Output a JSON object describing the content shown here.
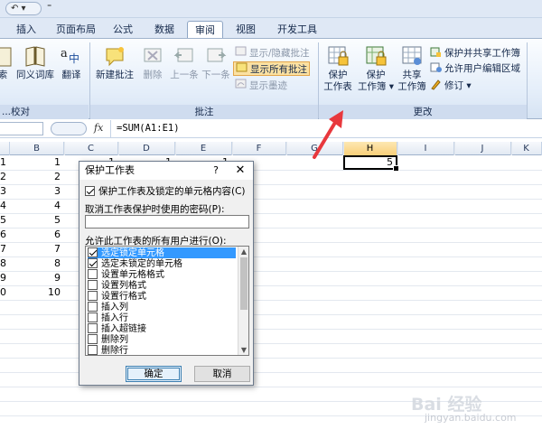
{
  "qat": {
    "undo_label": "↶ ▾",
    "caret": "⁼"
  },
  "tabs": [
    "插入",
    "页面布局",
    "公式",
    "数据",
    "审阅",
    "视图",
    "开发工具"
  ],
  "active_tab_index": 4,
  "ribbon": {
    "proofing": {
      "research_label": "...索",
      "thesaurus_label": "同义词库",
      "translate_label": "翻译",
      "group_label": "...校对"
    },
    "comments": {
      "new_comment_label": "新建批注",
      "delete_label": "删除",
      "previous_label": "上一条",
      "next_label": "下一条",
      "show_hide_label": "显示/隐藏批注",
      "show_all_label": "显示所有批注",
      "show_ink_label": "显示墨迹",
      "group_label": "批注"
    },
    "changes": {
      "protect_sheet_label_1": "保护",
      "protect_sheet_label_2": "工作表",
      "protect_workbook_label_1": "保护",
      "protect_workbook_label_2": "工作簿 ▾",
      "share_workbook_label_1": "共享",
      "share_workbook_label_2": "工作簿",
      "protect_share_label": "保护并共享工作簿",
      "allow_edit_label": "允许用户编辑区域",
      "track_changes_label": "修订 ▾",
      "group_label": "更改"
    }
  },
  "formula_bar": {
    "fx_label": "fx",
    "formula": "=SUM(A1:E1)"
  },
  "columns": [
    "B",
    "C",
    "D",
    "E",
    "F",
    "G",
    "H",
    "I",
    "J",
    "K"
  ],
  "selected_column": "H",
  "rows": [
    {
      "a": "1",
      "b": "1",
      "c": "1",
      "d": "1",
      "e": "1"
    },
    {
      "a": "2",
      "b": "2"
    },
    {
      "a": "3",
      "b": "3"
    },
    {
      "a": "4",
      "b": "4"
    },
    {
      "a": "5",
      "b": "5"
    },
    {
      "a": "6",
      "b": "6"
    },
    {
      "a": "7",
      "b": "7"
    },
    {
      "a": "8",
      "b": "8"
    },
    {
      "a": "9",
      "b": "9"
    },
    {
      "a": "0",
      "b": "10"
    }
  ],
  "active_cell_value": "5",
  "dialog": {
    "title": "保护工作表",
    "help": "?",
    "close": "✕",
    "protect_checkbox_label": "保护工作表及锁定的单元格内容(C)",
    "password_label": "取消工作表保护时使用的密码(P):",
    "password_value": "",
    "allow_label": "允许此工作表的所有用户进行(O):",
    "options": [
      {
        "label": "选定锁定单元格",
        "checked": true,
        "selected": true
      },
      {
        "label": "选定未锁定的单元格",
        "checked": true,
        "selected": false
      },
      {
        "label": "设置单元格格式",
        "checked": false,
        "selected": false
      },
      {
        "label": "设置列格式",
        "checked": false,
        "selected": false
      },
      {
        "label": "设置行格式",
        "checked": false,
        "selected": false
      },
      {
        "label": "插入列",
        "checked": false,
        "selected": false
      },
      {
        "label": "插入行",
        "checked": false,
        "selected": false
      },
      {
        "label": "插入超链接",
        "checked": false,
        "selected": false
      },
      {
        "label": "删除列",
        "checked": false,
        "selected": false
      },
      {
        "label": "删除行",
        "checked": false,
        "selected": false
      }
    ],
    "ok_label": "确定",
    "cancel_label": "取消"
  },
  "watermark": "Bai 经验",
  "watermark_sub": "jingyan.baidu.com",
  "colors": {
    "accent_arrow": "#e8383d",
    "selection": "#3399ff"
  }
}
